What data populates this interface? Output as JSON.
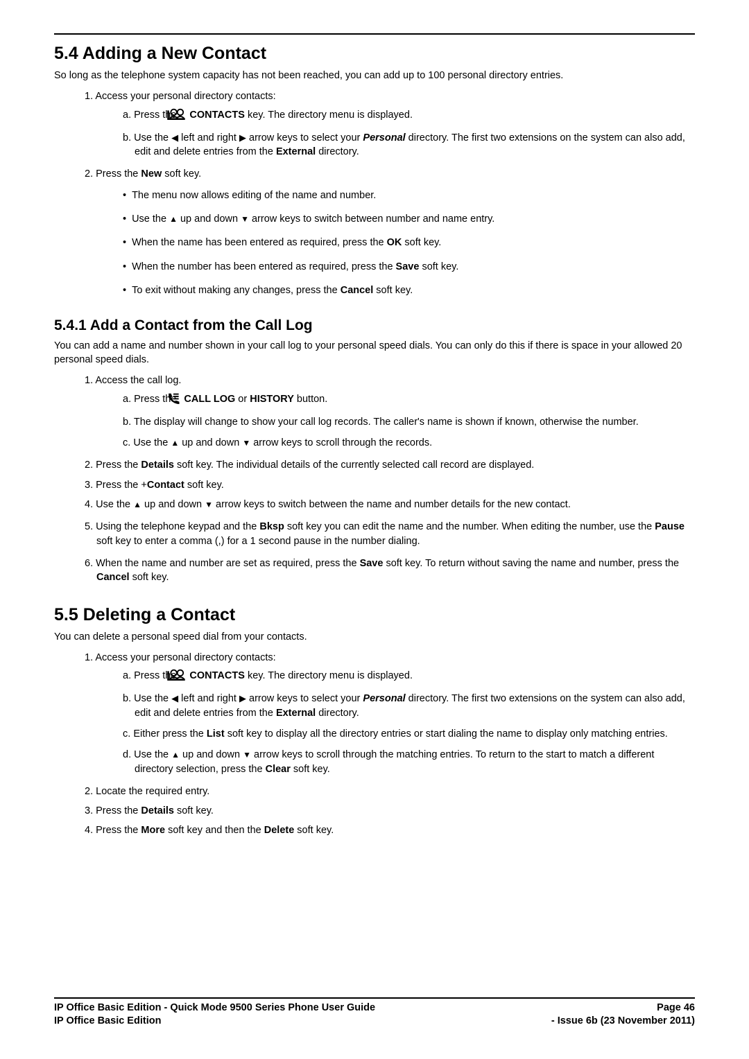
{
  "s54": {
    "heading": "5.4 Adding a New Contact",
    "intro": "So long as the telephone system capacity has not been reached, you can add up to 100 personal directory entries.",
    "step1": {
      "num": "1.",
      "text": "Access your personal directory contacts:",
      "a_num": "a.",
      "a_t1": "Press the ",
      "a_contacts": " CONTACTS",
      "a_t2": " key. The directory menu is displayed.",
      "b_num": "b.",
      "b_t1": "Use the ",
      "b_t2": " left and right ",
      "b_t3": " arrow keys to select your ",
      "b_personal": "Personal",
      "b_t4": " directory. The first two extensions on the system can also add, edit and delete entries from the ",
      "b_external": "External",
      "b_t5": " directory."
    },
    "step2": {
      "num": "2.",
      "t1": "Press the ",
      "new": "New",
      "t2": " soft key.",
      "b1": "The menu now allows editing of the name and number.",
      "b2_t1": "Use the ",
      "b2_t2": " up and down ",
      "b2_t3": " arrow keys to switch between number and name entry.",
      "b3_t1": "When the name has been entered as required, press the ",
      "b3_ok": "OK",
      "b3_t2": " soft key.",
      "b4_t1": "When the number has been entered as required, press the ",
      "b4_save": "Save",
      "b4_t2": " soft key.",
      "b5_t1": "To exit without making any changes, press the ",
      "b5_cancel": "Cancel",
      "b5_t2": " soft key."
    }
  },
  "s541": {
    "heading": "5.4.1 Add a Contact from the Call Log",
    "intro": "You can add a name and number shown in your call log to your personal speed dials. You can only do this if there is space in your allowed 20 personal speed dials.",
    "step1": {
      "num": "1.",
      "text": "Access the call log.",
      "a_num": "a.",
      "a_t1": "Press the ",
      "a_calllog": " CALL LOG",
      "a_or": " or ",
      "a_history": "HISTORY",
      "a_t2": " button.",
      "b_num": "b.",
      "b_text": "The display will change to show your call log records. The caller's name is shown if known, otherwise the number.",
      "c_num": "c.",
      "c_t1": "Use the ",
      "c_t2": " up and down ",
      "c_t3": " arrow keys to scroll through the records."
    },
    "step2": {
      "num": "2.",
      "t1": "Press the ",
      "details": "Details",
      "t2": " soft key. The individual details of the currently selected call record are displayed."
    },
    "step3": {
      "num": "3.",
      "t1": "Press the +",
      "contact": "Contact",
      "t2": " soft key."
    },
    "step4": {
      "num": "4.",
      "t1": "Use the ",
      "t2": " up and down ",
      "t3": " arrow keys to switch between the name and number details for the new contact."
    },
    "step5": {
      "num": "5.",
      "t1": "Using the telephone keypad and the ",
      "bksp": "Bksp",
      "t2": " soft key you can edit the name and the number. When editing the number, use the ",
      "pause": "Pause",
      "t3": " soft key to enter a comma (,) for a 1 second pause in the number dialing."
    },
    "step6": {
      "num": "6.",
      "t1": "When the name and number are set as required, press the ",
      "save": "Save",
      "t2": " soft key. To return without saving the name and number, press the ",
      "cancel": "Cancel",
      "t3": " soft key."
    }
  },
  "s55": {
    "heading": "5.5 Deleting a Contact",
    "intro": "You can delete a personal speed dial from your contacts.",
    "step1": {
      "num": "1.",
      "text": "Access your personal directory contacts:",
      "a_num": "a.",
      "a_t1": "Press the ",
      "a_contacts": " CONTACTS",
      "a_t2": " key. The directory menu is displayed.",
      "b_num": "b.",
      "b_t1": "Use the ",
      "b_t2": " left and right ",
      "b_t3": " arrow keys to select your ",
      "b_personal": "Personal",
      "b_t4": " directory. The first two extensions on the system can also add, edit and delete entries from the ",
      "b_external": "External",
      "b_t5": " directory.",
      "c_num": "c.",
      "c_t1": "Either press the ",
      "c_list": "List",
      "c_t2": " soft key to display all the directory entries or start dialing the name to display only matching entries.",
      "d_num": "d.",
      "d_t1": "Use the ",
      "d_t2": " up and down ",
      "d_t3": " arrow keys to scroll through the matching entries. To return to the start to match a different directory selection, press the ",
      "d_clear": "Clear",
      "d_t4": " soft key."
    },
    "step2": {
      "num": "2.",
      "text": "Locate the required entry."
    },
    "step3": {
      "num": "3.",
      "t1": "Press the ",
      "details": "Details",
      "t2": " soft key."
    },
    "step4": {
      "num": "4.",
      "t1": "Press the ",
      "more": "More",
      "t2": " soft key and then the ",
      "delete": "Delete",
      "t3": " soft key."
    }
  },
  "footer": {
    "left1": "IP Office Basic Edition - Quick Mode 9500 Series Phone User Guide",
    "right1": "Page 46",
    "left2": "IP Office Basic Edition",
    "right2": "- Issue 6b (23 November 2011)"
  }
}
